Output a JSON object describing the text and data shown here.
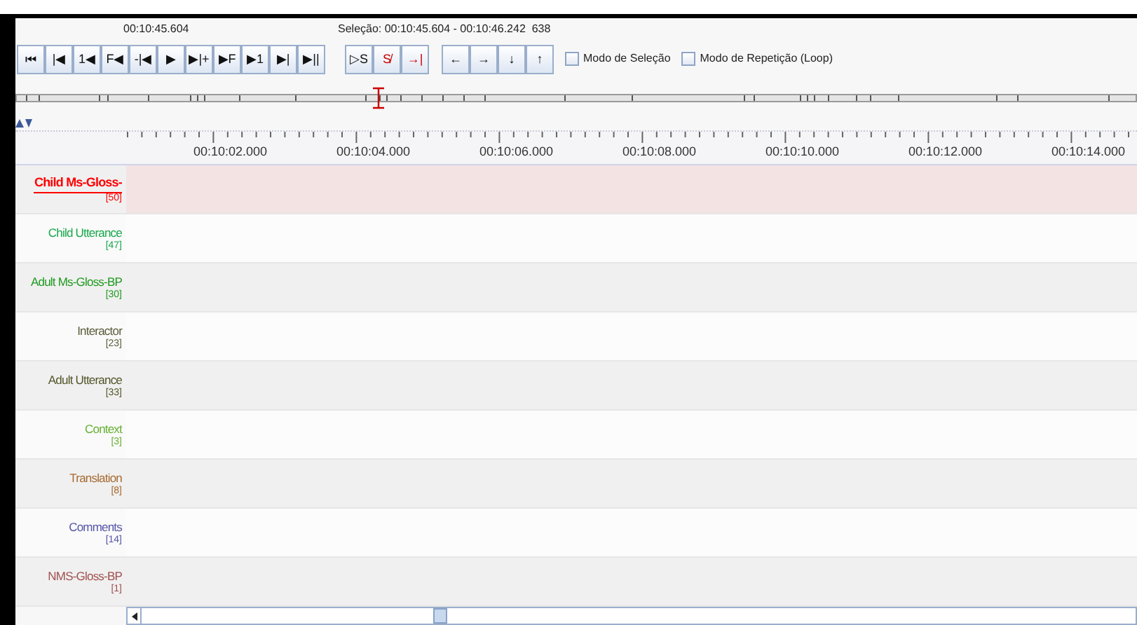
{
  "toolbar": {
    "current_time": "00:10:45.604",
    "selection": "Seleção: 00:10:45.604 - 00:10:46.242  638",
    "playback_buttons": [
      "⏮",
      "|◀",
      "1◀",
      "F◀",
      "-|◀",
      "▶",
      "▶|+",
      "▶F",
      "▶1",
      "▶|",
      "▶||"
    ],
    "selection_buttons": [
      "▷S",
      "S̸",
      "→|"
    ],
    "navigation_buttons": [
      "←",
      "→",
      "↓",
      "↑"
    ],
    "options": [
      {
        "label": "Modo de Seleção",
        "checked": false
      },
      {
        "label": "Modo de Repetição (Loop)",
        "checked": false
      }
    ]
  },
  "ruler": {
    "labels": [
      "00:10:02.000",
      "00:10:04.000",
      "00:10:06.000",
      "00:10:08.000",
      "00:10:10.000",
      "00:10:12.000",
      "00:10:14.000"
    ]
  },
  "tiers": [
    {
      "name": "Child Ms-Gloss-",
      "count": "[50]",
      "color": "#ff0000",
      "selected": true
    },
    {
      "name": "Child Utterance",
      "count": "[47]",
      "color": "#17a84b",
      "selected": false
    },
    {
      "name": "Adult Ms-Gloss-BP",
      "count": "[30]",
      "color": "#1f9a1f",
      "selected": false
    },
    {
      "name": "Interactor",
      "count": "[23]",
      "color": "#5c5c3a",
      "selected": false
    },
    {
      "name": "Adult Utterance",
      "count": "[33]",
      "color": "#55552a",
      "selected": false
    },
    {
      "name": "Context",
      "count": "[3]",
      "color": "#66b032",
      "selected": false
    },
    {
      "name": "Translation",
      "count": "[8]",
      "color": "#a86a32",
      "selected": false
    },
    {
      "name": "Comments",
      "count": "[14]",
      "color": "#5555aa",
      "selected": false
    },
    {
      "name": "NMS-Gloss-BP",
      "count": "[1]",
      "color": "#a05050",
      "selected": false
    }
  ]
}
